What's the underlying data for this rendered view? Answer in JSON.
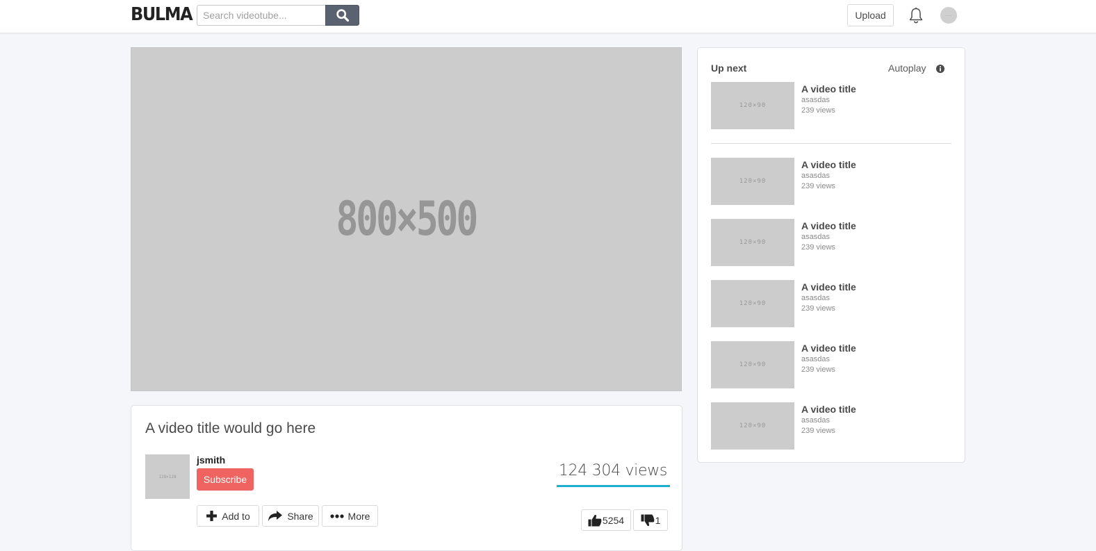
{
  "navbar": {
    "logo": "BULMA",
    "search_placeholder": "Search videotube...",
    "upload_label": "Upload",
    "avatar_placeholder": "···"
  },
  "player": {
    "placeholder": "800×500"
  },
  "video": {
    "title": "A video title would go here",
    "channel_thumb_placeholder": "128×128",
    "channel": "jsmith",
    "subscribe_label": "Subscribe",
    "views": "124 304 views",
    "actions": {
      "add_to": "Add to",
      "share": "Share",
      "more": "More"
    },
    "likes": "5254",
    "dislikes": "1"
  },
  "up_next": {
    "title": "Up next",
    "autoplay_label": "Autoplay",
    "items": [
      {
        "thumb": "120×90",
        "title": "A video title",
        "channel": "asasdas",
        "views": "239 views"
      },
      {
        "thumb": "120×90",
        "title": "A video title",
        "channel": "asasdas",
        "views": "239 views"
      },
      {
        "thumb": "120×90",
        "title": "A video title",
        "channel": "asasdas",
        "views": "239 views"
      },
      {
        "thumb": "120×90",
        "title": "A video title",
        "channel": "asasdas",
        "views": "239 views"
      },
      {
        "thumb": "120×90",
        "title": "A video title",
        "channel": "asasdas",
        "views": "239 views"
      },
      {
        "thumb": "120×90",
        "title": "A video title",
        "channel": "asasdas",
        "views": "239 views"
      }
    ]
  },
  "colors": {
    "subscribe": "#ef6461",
    "views_bar": "#1eaece",
    "search_button": "#5a6270"
  }
}
